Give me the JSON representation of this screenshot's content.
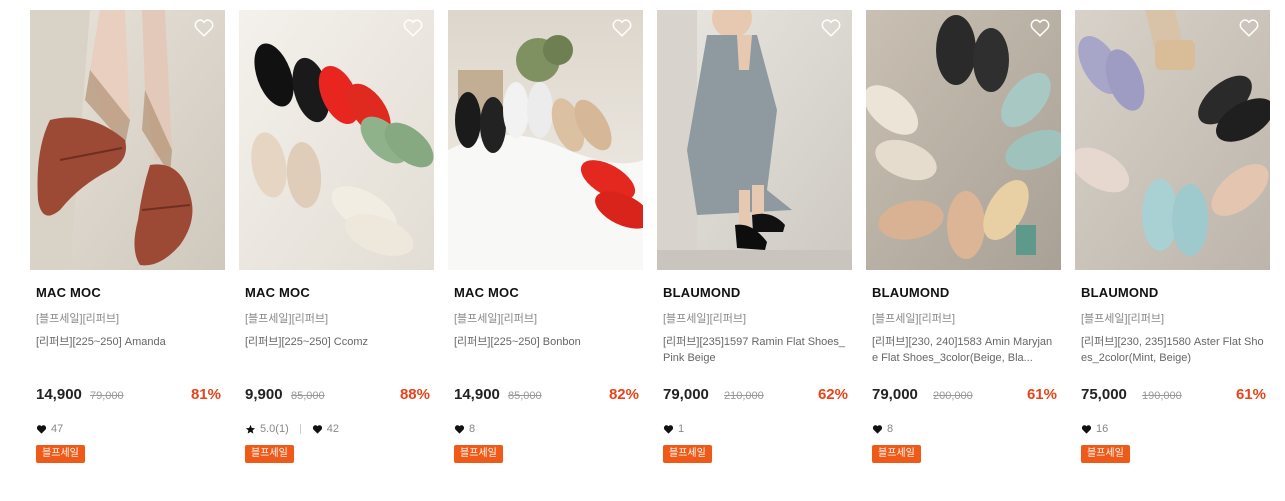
{
  "products": [
    {
      "brand": "MAC MOC",
      "tag": "[블프세일][리퍼브]",
      "name": "[리퍼브][225~250] Amanda",
      "price": "14,900",
      "original_price": "79,000",
      "discount": "81%",
      "rating": "",
      "likes": "47",
      "badge": "블프세일",
      "image": "shoe-photo-red-suede-flats"
    },
    {
      "brand": "MAC MOC",
      "tag": "[블프세일][리퍼브]",
      "name": "[리퍼브][225~250] Ccomz",
      "price": "9,900",
      "original_price": "85,000",
      "discount": "88%",
      "rating": "5.0(1)",
      "likes": "42",
      "badge": "블프세일",
      "image": "shoe-photo-bow-ballet-flats"
    },
    {
      "brand": "MAC MOC",
      "tag": "[블프세일][리퍼브]",
      "name": "[리퍼브][225~250] Bonbon",
      "price": "14,900",
      "original_price": "85,000",
      "discount": "82%",
      "rating": "",
      "likes": "8",
      "badge": "블프세일",
      "image": "shoe-photo-mary-jane-flats"
    },
    {
      "brand": "BLAUMOND",
      "tag": "[블프세일][리퍼브]",
      "name": "[리퍼브][235]1597 Ramin Flat Shoes_Pink Beige",
      "price": "79,000",
      "original_price": "210,000",
      "discount": "62%",
      "rating": "",
      "likes": "1",
      "badge": "블프세일",
      "image": "shoe-photo-model-black-shoes"
    },
    {
      "brand": "BLAUMOND",
      "tag": "[블프세일][리퍼브]",
      "name": "[리퍼브][230, 240]1583 Amin Maryjane Flat Shoes_3color(Beige, Bla...",
      "price": "79,000",
      "original_price": "200,000",
      "discount": "61%",
      "rating": "",
      "likes": "8",
      "badge": "블프세일",
      "image": "shoe-photo-maryjane-circle"
    },
    {
      "brand": "BLAUMOND",
      "tag": "[블프세일][리퍼브]",
      "name": "[리퍼브][230, 235]1580 Aster Flat Shoes_2color(Mint, Beige)",
      "price": "75,000",
      "original_price": "190,000",
      "discount": "61%",
      "rating": "",
      "likes": "16",
      "badge": "블프세일",
      "image": "shoe-photo-aster-circle"
    }
  ],
  "colors": {
    "discount": "#e8431a",
    "badge": "#f05a19"
  },
  "icons": {
    "wishlist": "heart-outline-icon",
    "likes": "heart-filled-icon",
    "rating": "star-icon"
  }
}
